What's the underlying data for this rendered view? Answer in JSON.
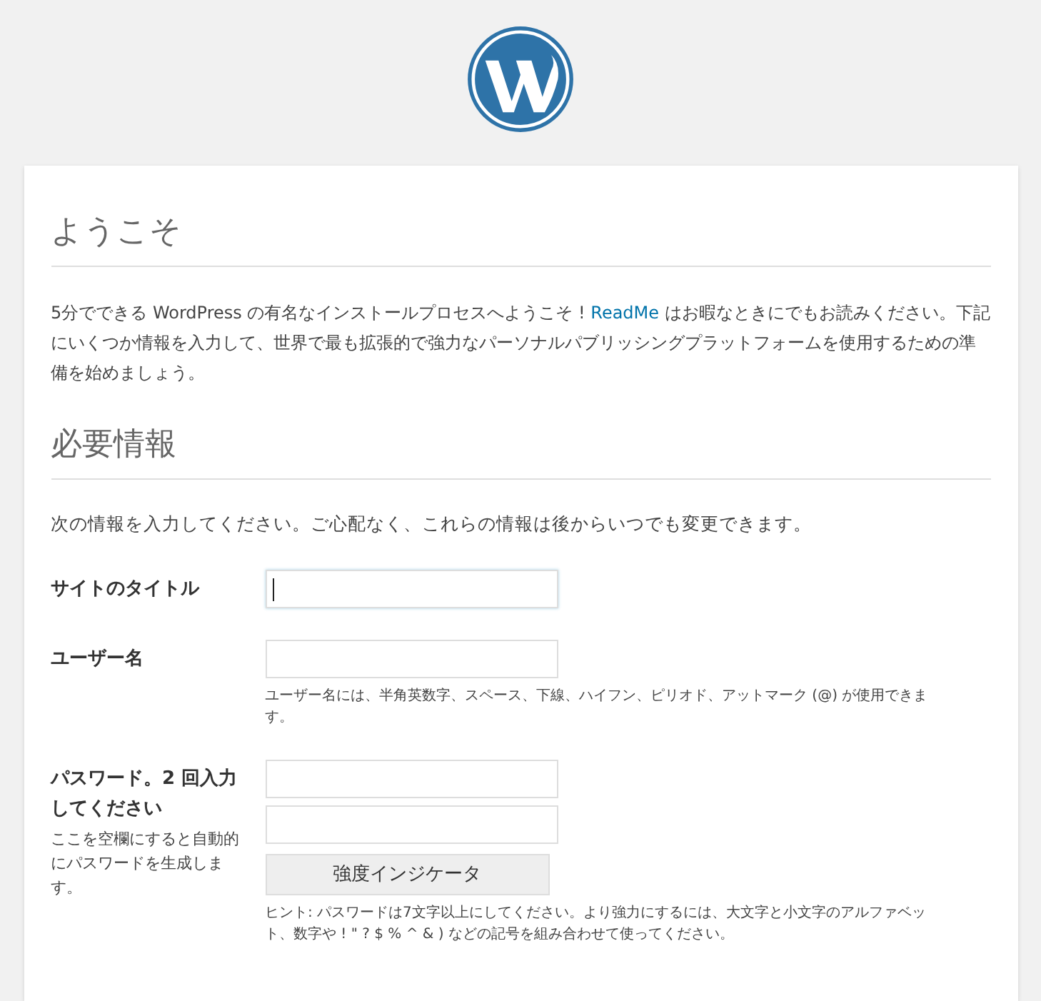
{
  "welcome": {
    "heading": "ようこそ",
    "intro": {
      "before": "5分でできる WordPress の有名なインストールプロセスへようこそ ! ",
      "link": "ReadMe",
      "after": " はお暇なときにでもお読みください。下記にいくつか情報を入力して、世界で最も拡張的で強力なパーソナルパブリッシングプラットフォームを使用するための準備を始めましょう。"
    }
  },
  "required": {
    "heading": "必要情報",
    "description": "次の情報を入力してください。ご心配なく、これらの情報は後からいつでも変更できます。",
    "fields": [
      {
        "kind": "text",
        "label": "サイトのタイトル",
        "inputs": [
          {
            "focused": true
          }
        ]
      },
      {
        "kind": "text",
        "label": "ユーザー名",
        "inputs": [
          {
            "focused": false
          }
        ],
        "help": "ユーザー名には、半角英数字、スペース、下線、ハイフン、ピリオド、アットマーク (@) が使用できます。"
      },
      {
        "kind": "password",
        "label": "パスワード。2 回入力してください",
        "note": "ここを空欄にすると自動的にパスワードを生成します。",
        "inputs": [
          {
            "focused": false
          },
          {
            "focused": false
          }
        ],
        "meter": "強度インジケータ",
        "help": "ヒント: パスワードは7文字以上にしてください。より強力にするには、大文字と小文字のアルファベット、数字や ! \" ? $ % ^ & ) などの記号を組み合わせて使ってください。"
      }
    ]
  }
}
